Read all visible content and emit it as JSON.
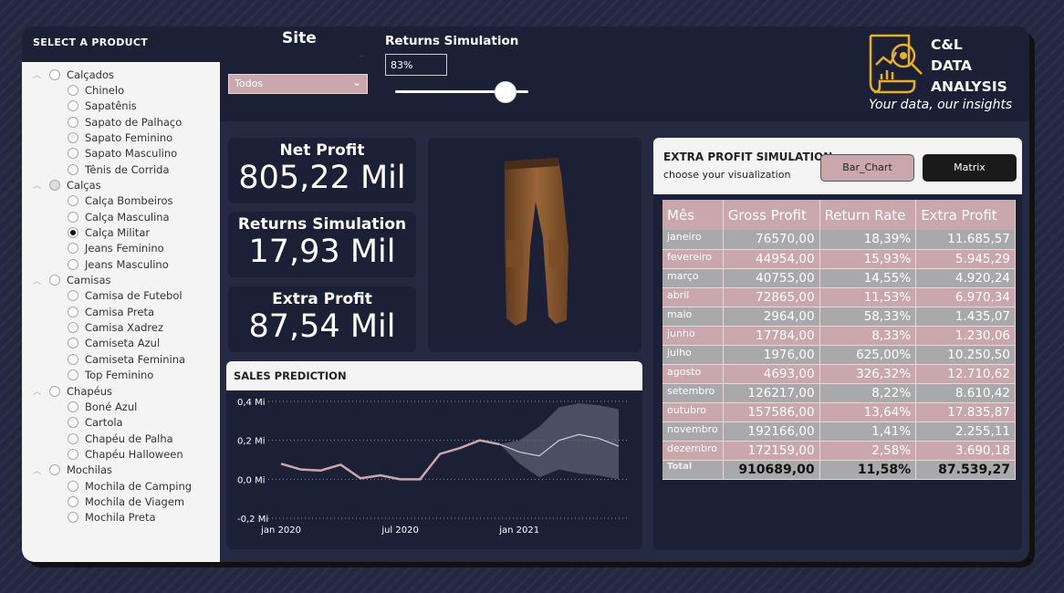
{
  "left_panel": {
    "title": "SELECT A PRODUCT",
    "groups": [
      {
        "label": "Calçados",
        "items": [
          "Chinelo",
          "Sapatênis",
          "Sapato de Palhaço",
          "Sapato Feminino",
          "Sapato Masculino",
          "Tênis de Corrida"
        ]
      },
      {
        "label": "Calças",
        "items": [
          "Calça Bombeiros",
          "Calça Masculina",
          "Calça Militar",
          "Jeans Feminino",
          "Jeans Masculino"
        ]
      },
      {
        "label": "Camisas",
        "items": [
          "Camisa de Futebol",
          "Camisa Preta",
          "Camisa Xadrez",
          "Camiseta Azul",
          "Camiseta Feminina",
          "Top Feminino"
        ]
      },
      {
        "label": "Chapéus",
        "items": [
          "Boné Azul",
          "Cartola",
          "Chapéu de Palha",
          "Chapéu Halloween"
        ]
      },
      {
        "label": "Mochilas",
        "items": [
          "Mochila de Camping",
          "Mochila de Viagem",
          "Mochila Preta"
        ]
      }
    ],
    "selected_group": "Calças",
    "selected_item": "Calça Militar"
  },
  "site": {
    "label": "Site",
    "value": "Todos"
  },
  "returns": {
    "label": "Returns Simulation",
    "input_value": "83%",
    "slider_level": 0.83
  },
  "logo": {
    "line1": "C&L",
    "line2": "DATA",
    "line3": "ANALYSIS",
    "tagline": "Your data, our insights",
    "accent": "#e8b21f"
  },
  "kpis": [
    {
      "title": "Net Profit",
      "value": "805,22 Mil"
    },
    {
      "title": "Returns Simulation",
      "value": "17,93 Mil"
    },
    {
      "title": "Extra Profit",
      "value": "87,54 Mil"
    }
  ],
  "sales_prediction": {
    "title": "SALES PREDICTION",
    "chart_data": {
      "type": "line",
      "x": [
        "2020-01",
        "2020-02",
        "2020-03",
        "2020-04",
        "2020-05",
        "2020-06",
        "2020-07",
        "2020-08",
        "2020-09",
        "2020-10",
        "2020-11",
        "2020-12",
        "2021-01",
        "2021-02",
        "2021-03",
        "2021-04",
        "2021-05",
        "2021-06"
      ],
      "series": [
        {
          "values": [
            0.08,
            0.05,
            0.045,
            0.075,
            0.005,
            0.02,
            0.0,
            0.0,
            0.13,
            0.16,
            0.2,
            0.18,
            null,
            null,
            null,
            null,
            null,
            null
          ],
          "color": "#c9a7ad"
        },
        {
          "values": [
            null,
            null,
            null,
            null,
            null,
            null,
            null,
            null,
            null,
            null,
            null,
            0.18,
            0.14,
            0.12,
            0.2,
            0.23,
            0.21,
            0.17
          ],
          "color": "#d0d0d0"
        }
      ],
      "band_upper": [
        null,
        null,
        null,
        null,
        null,
        null,
        null,
        null,
        null,
        null,
        null,
        0.18,
        0.2,
        0.27,
        0.37,
        0.39,
        0.38,
        0.36
      ],
      "band_lower": [
        null,
        null,
        null,
        null,
        null,
        null,
        null,
        null,
        null,
        null,
        null,
        0.18,
        0.08,
        0.01,
        0.05,
        0.03,
        0.02,
        0.0
      ],
      "yticks": [
        "0,4 Mi",
        "0,2 Mi",
        "0,0 Mi",
        "-0,2 Mi"
      ],
      "ytick_values": [
        0.4,
        0.2,
        0.0,
        -0.2
      ],
      "xticks": [
        "jan 2020",
        "jul 2020",
        "jan 2021"
      ],
      "xtick_index": [
        0,
        6,
        12
      ],
      "ylim": [
        -0.2,
        0.4
      ],
      "grid": true
    }
  },
  "extra_profit": {
    "title": "EXTRA PROFIT SIMULATION",
    "subtitle": "choose your visualization",
    "btn_bar": "Bar_Chart",
    "btn_matrix": "Matrix",
    "headers": [
      "Mês",
      "Gross Profit",
      "Return Rate",
      "Extra Profit"
    ],
    "rows": [
      [
        "janeiro",
        "76570,00",
        "18,39%",
        "11.685,57"
      ],
      [
        "fevereiro",
        "44954,00",
        "15,93%",
        "5.945,29"
      ],
      [
        "março",
        "40755,00",
        "14,55%",
        "4.920,24"
      ],
      [
        "abril",
        "72865,00",
        "11,53%",
        "6.970,34"
      ],
      [
        "maio",
        "2964,00",
        "58,33%",
        "1.435,07"
      ],
      [
        "junho",
        "17784,00",
        "8,33%",
        "1.230,06"
      ],
      [
        "julho",
        "1976,00",
        "625,00%",
        "10.250,50"
      ],
      [
        "agosto",
        "4693,00",
        "326,32%",
        "12.710,62"
      ],
      [
        "setembro",
        "126217,00",
        "8,22%",
        "8.610,42"
      ],
      [
        "outubro",
        "157586,00",
        "13,64%",
        "17.835,87"
      ],
      [
        "novembro",
        "192166,00",
        "1,41%",
        "2.255,11"
      ],
      [
        "dezembro",
        "172159,00",
        "2,58%",
        "3.690,18"
      ]
    ],
    "total": [
      "Total",
      "910689,00",
      "11,58%",
      "87.539,27"
    ]
  }
}
